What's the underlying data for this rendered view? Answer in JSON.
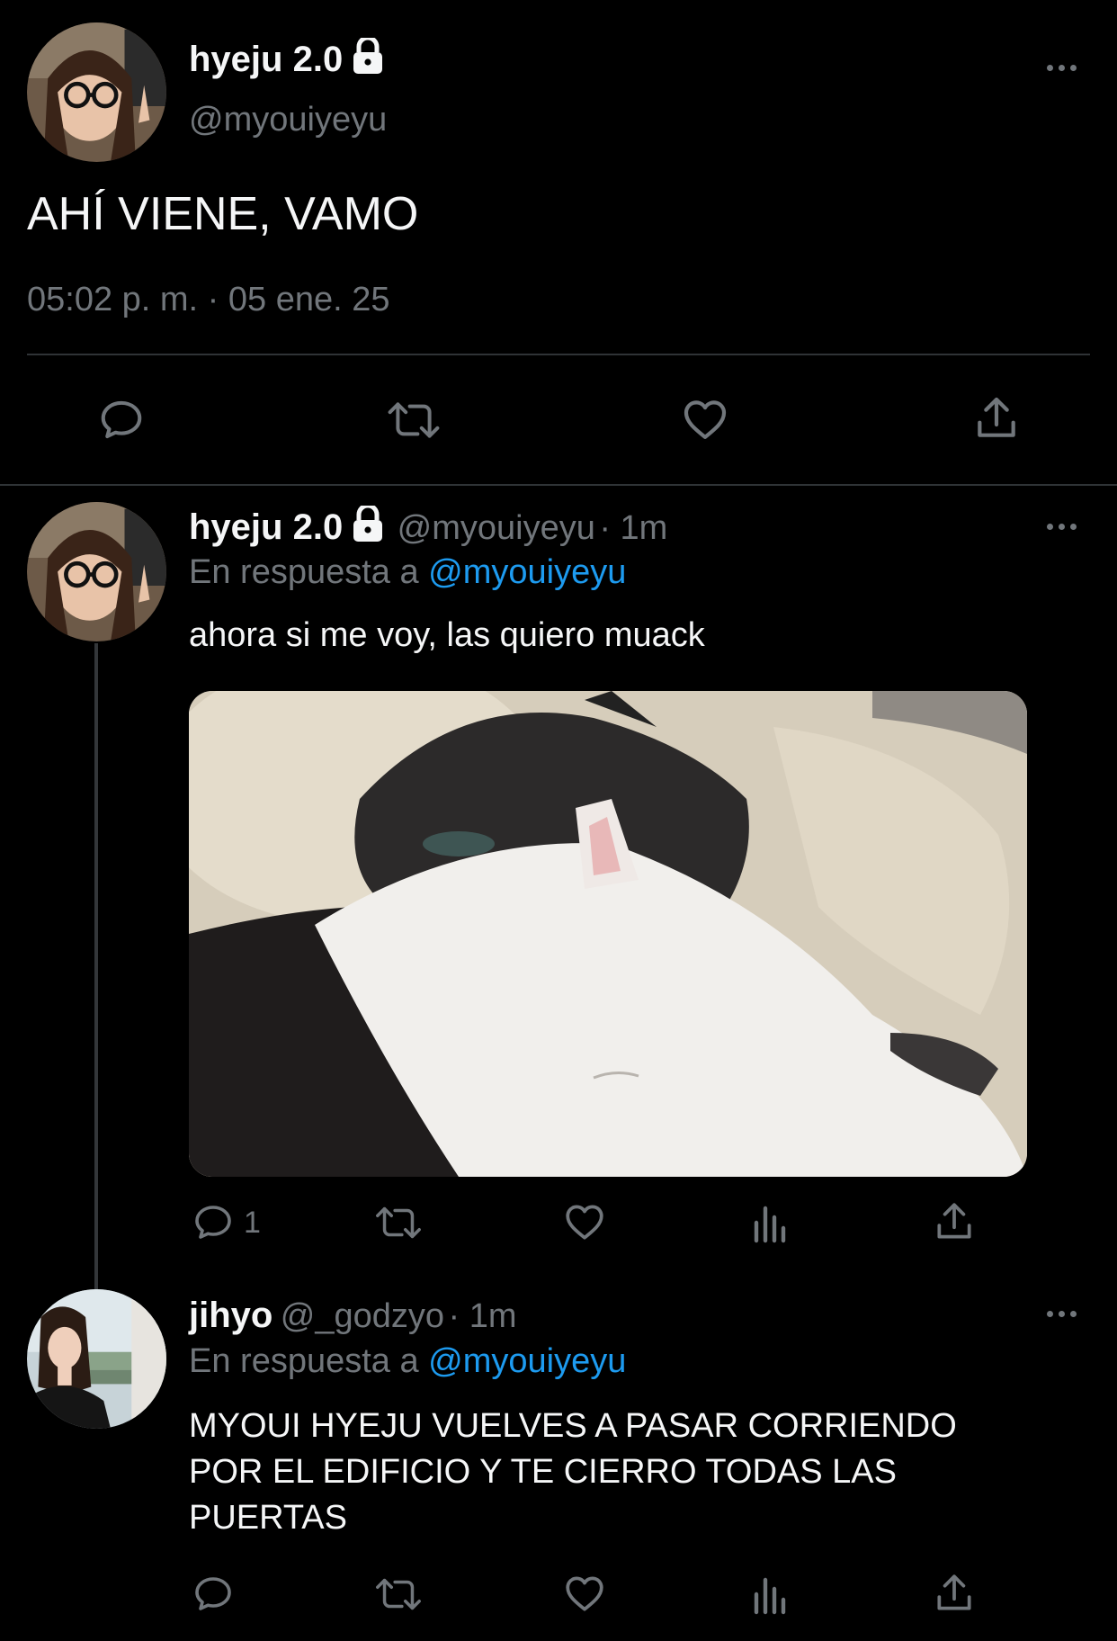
{
  "main_tweet": {
    "display_name": "hyeju 2.0",
    "handle": "@myouiyeyu",
    "text": "AHÍ VIENE, VAMO",
    "timestamp": "05:02 p. m. · 05 ene. 25",
    "icons": {
      "reply": "reply-icon",
      "retweet": "retweet-icon",
      "like": "heart-icon",
      "share": "share-icon"
    }
  },
  "reply1": {
    "display_name": "hyeju 2.0",
    "handle": "@myouiyeyu",
    "time": "· 1m",
    "reply_prefix": "En respuesta a",
    "reply_to": "@myouiyeyu",
    "text": "ahora si me voy, las quiero muack",
    "reply_count": "1"
  },
  "reply2": {
    "display_name": "jihyo",
    "handle": "@_godzyo",
    "time": "· 1m",
    "reply_prefix": "En respuesta a",
    "reply_to": "@myouiyeyu",
    "text_line1": "MYOUI HYEJU VUELVES A PASAR CORRIENDO",
    "text_line2": "POR EL EDIFICIO Y TE CIERRO TODAS LAS",
    "text_line3": "PUERTAS"
  },
  "colors": {
    "background": "#000000",
    "text": "#e7e9ea",
    "secondary": "#71767b",
    "link": "#1d9bf0",
    "divider": "#2f3336"
  }
}
